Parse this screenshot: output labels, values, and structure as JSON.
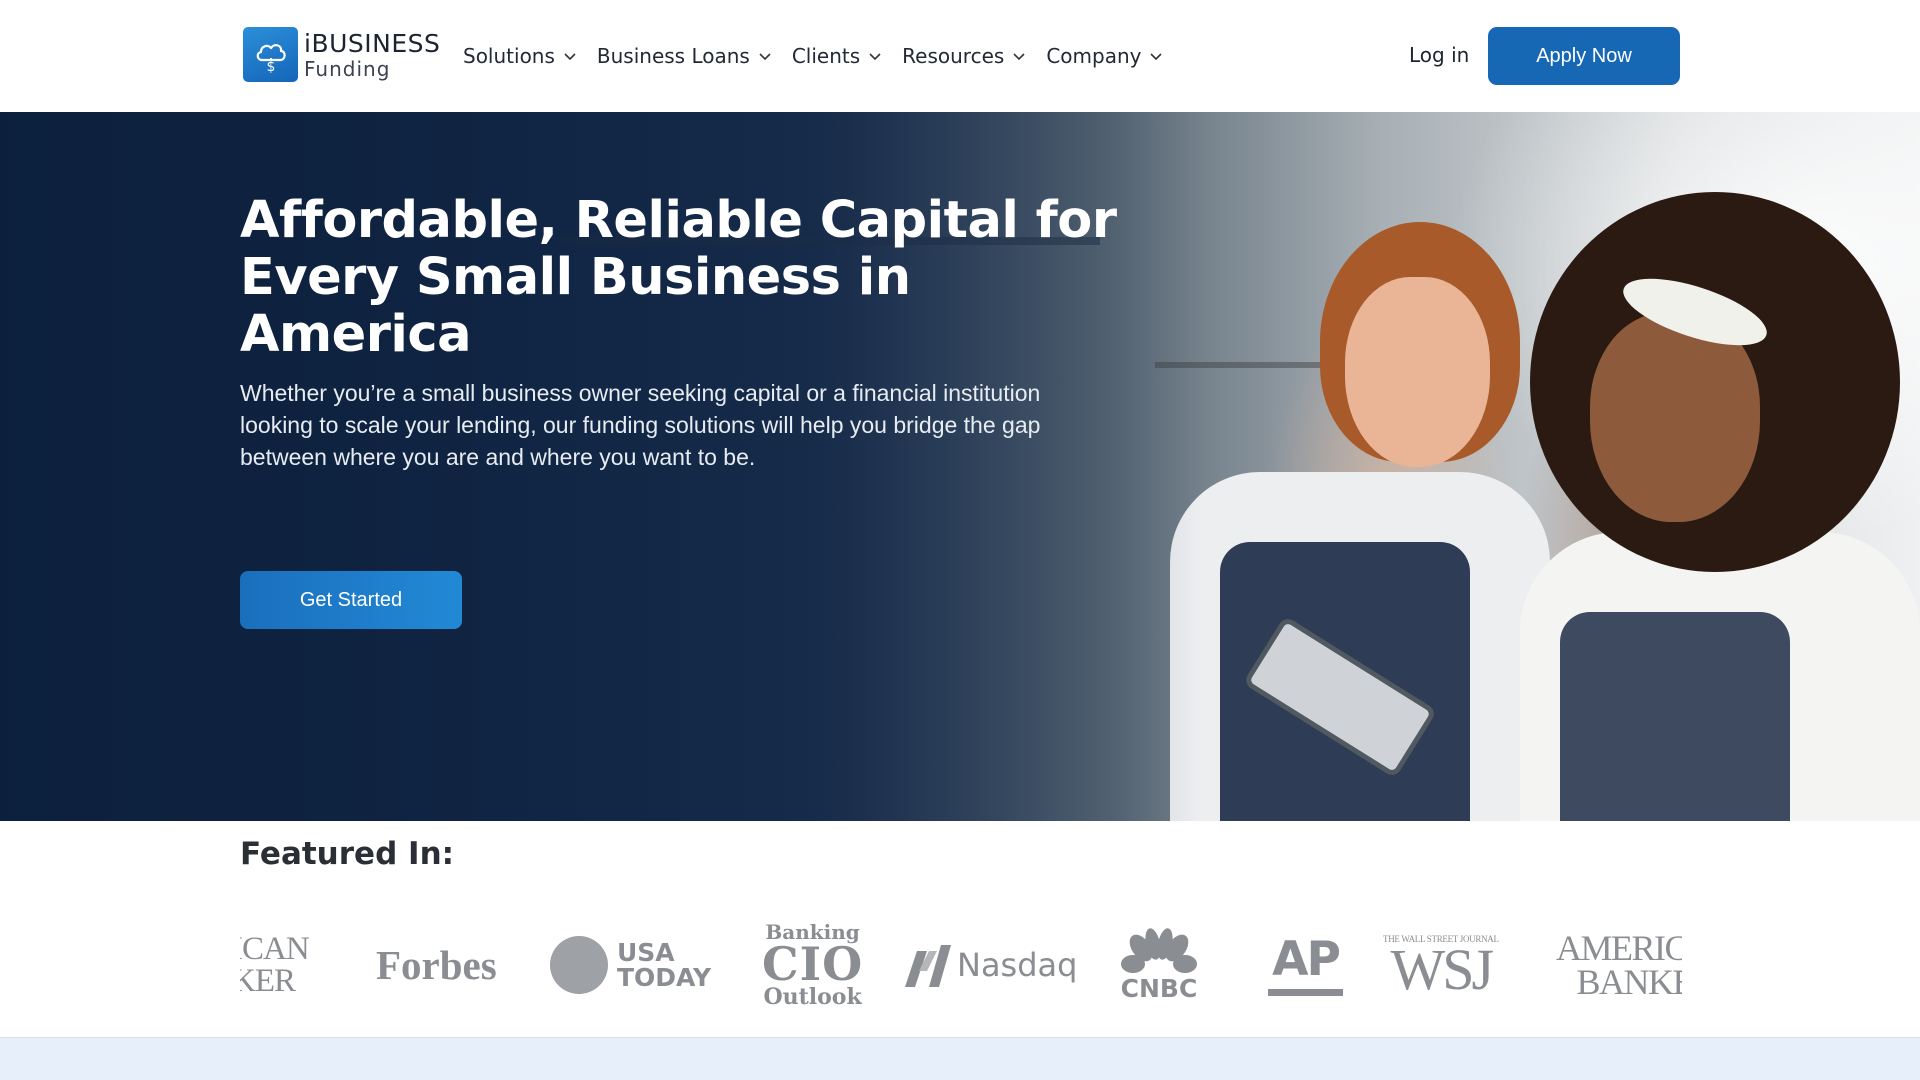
{
  "brand": {
    "name_line1": "iBUSINESS",
    "name_line2": "Funding",
    "icon": "cloud-dollar-icon",
    "color": "#1668b4"
  },
  "nav": {
    "items": [
      {
        "label": "Solutions"
      },
      {
        "label": "Business Loans"
      },
      {
        "label": "Clients"
      },
      {
        "label": "Resources"
      },
      {
        "label": "Company"
      }
    ],
    "chevron_icon": "chevron-down-icon"
  },
  "header": {
    "login_label": "Log in",
    "apply_label": "Apply Now"
  },
  "hero": {
    "title_line1": "Affordable, Reliable Capital for",
    "title_line2": "Every Small Business in America",
    "subtitle": "Whether you’re a small business owner seeking capital or a financial institution looking to scale your lending, our funding solutions will help you bridge the gap between where you are and where you want to be.",
    "cta_label": "Get Started"
  },
  "featured": {
    "title": "Featured In:",
    "logos": {
      "american_banker_partial_1": "ICAN",
      "american_banker_partial_2": "KER",
      "forbes": "Forbes",
      "usa_today_1": "USA",
      "usa_today_2": "TODAY",
      "banking_cio_1": "Banking",
      "banking_cio_2": "CIO",
      "banking_cio_3": "Outlook",
      "nasdaq": "Nasdaq",
      "cnbc": "CNBC",
      "ap": "AP",
      "wsj_small": "THE WALL STREET JOURNAL",
      "wsj": "WSJ",
      "american_banker_1": "AMERICAN",
      "american_banker_2": "BANKER"
    }
  },
  "colors": {
    "accent": "#1668b4",
    "hero_dark": "#0f2442",
    "logo_gray": "#8a8d91",
    "bottom_band": "#e6effa"
  }
}
